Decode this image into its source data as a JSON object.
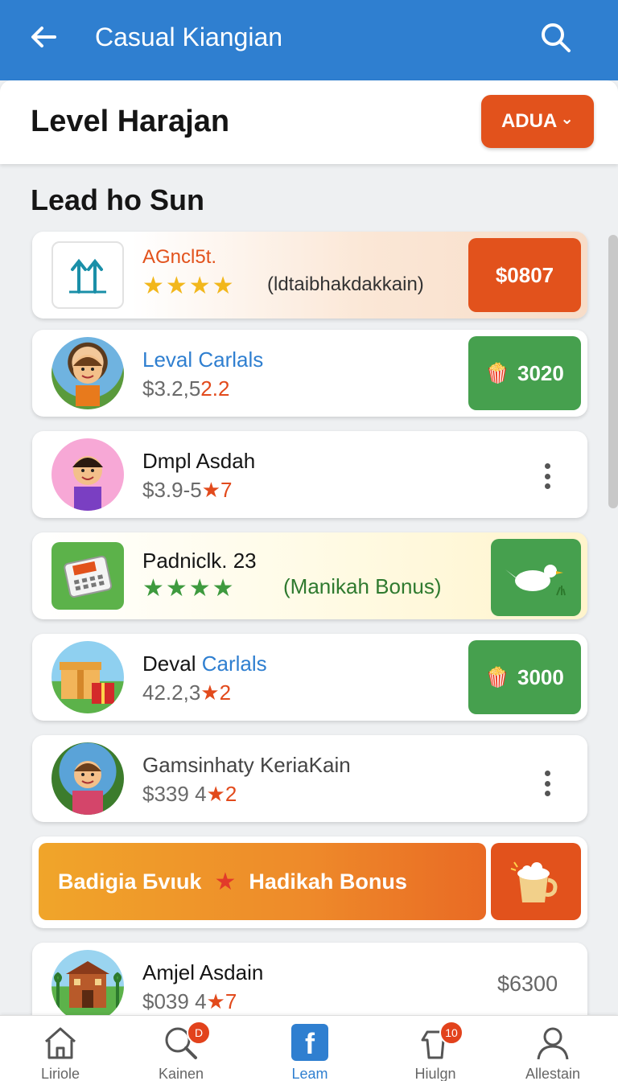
{
  "appbar": {
    "title": "Casual Kiangian",
    "back_icon": "arrow-left-icon",
    "search_icon": "search-icon"
  },
  "header": {
    "title": "Level Harajan",
    "button_label": "ADUA",
    "button_chevron": "⌄"
  },
  "section": {
    "title": "Lead ho Sun"
  },
  "rows": [
    {
      "name": "AGncl5t.",
      "stars": "★★★★",
      "note": "(ldtaibhakdakkain)",
      "price": "$0807",
      "icon": "chart-up-icon"
    },
    {
      "name": "Leval Carlals",
      "sub_main": "$3.2,5",
      "sub_hl": "2.2",
      "pill": "3020",
      "pill_icon": "popcorn-icon",
      "avatar": "boy-avatar"
    },
    {
      "name": "Dmpl Asdah",
      "sub_main": "$3.9-5",
      "sub_hl": "★7",
      "avatar": "child-avatar"
    },
    {
      "name": "Padniclk. 23",
      "stars": "★★★★",
      "note": "(Manikah Bonus)",
      "icon": "calculator-icon",
      "reward_icon": "bird-icon"
    },
    {
      "name_a": "Deval",
      "name_b": "Carlals",
      "sub_main": "42.2,3",
      "sub_hl": "★2",
      "pill": "3000",
      "pill_icon": "popcorn-icon",
      "avatar": "gift-avatar"
    },
    {
      "name": "Gamsinhaty KeriaKain",
      "sub_main": "$339 4",
      "sub_hl": "★2",
      "avatar": "kid-avatar"
    },
    {
      "banner_a": "Badigia Бvιuk",
      "banner_star": "★",
      "banner_b": "Hadikah Bonus",
      "reward_icon": "coffee-cup-icon"
    },
    {
      "name": "Amjel Asdain",
      "sub_main": "$039 4",
      "sub_hl": "★7",
      "price": "$6300",
      "avatar": "building-avatar"
    }
  ],
  "nav": [
    {
      "label": "Liriole",
      "icon": "home-icon"
    },
    {
      "label": "Kainen",
      "icon": "search-icon",
      "badge": "D"
    },
    {
      "label": "Leam",
      "icon": "facebook-icon"
    },
    {
      "label": "Hiulgn",
      "icon": "bag-icon",
      "badge": "10"
    },
    {
      "label": "Allestain",
      "icon": "user-icon"
    }
  ],
  "colors": {
    "appbar": "#2f7fd0",
    "accent_orange": "#e2521c",
    "accent_green": "#46a04e"
  }
}
